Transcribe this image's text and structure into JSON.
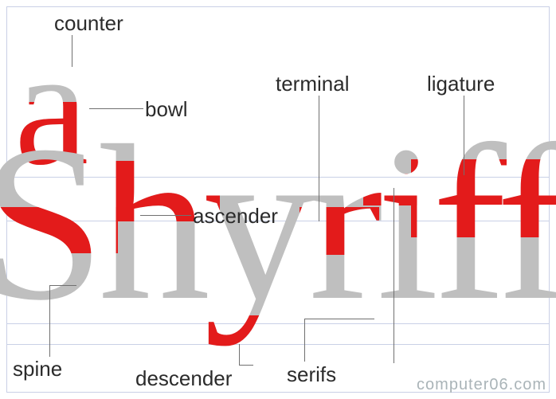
{
  "labels": {
    "counter": "counter",
    "bowl": "bowl",
    "terminal": "terminal",
    "ligature": "ligature",
    "ascender": "ascender",
    "spine": "spine",
    "descender": "descender",
    "serifs": "serifs"
  },
  "letters": {
    "a": "a",
    "word": "Shyriff"
  },
  "colors": {
    "highlight": "#e31b1b",
    "base_glyph": "#bfbfbf",
    "leader": "#707070",
    "guideline": "#c9d0e6"
  },
  "watermark": "computer06.com"
}
